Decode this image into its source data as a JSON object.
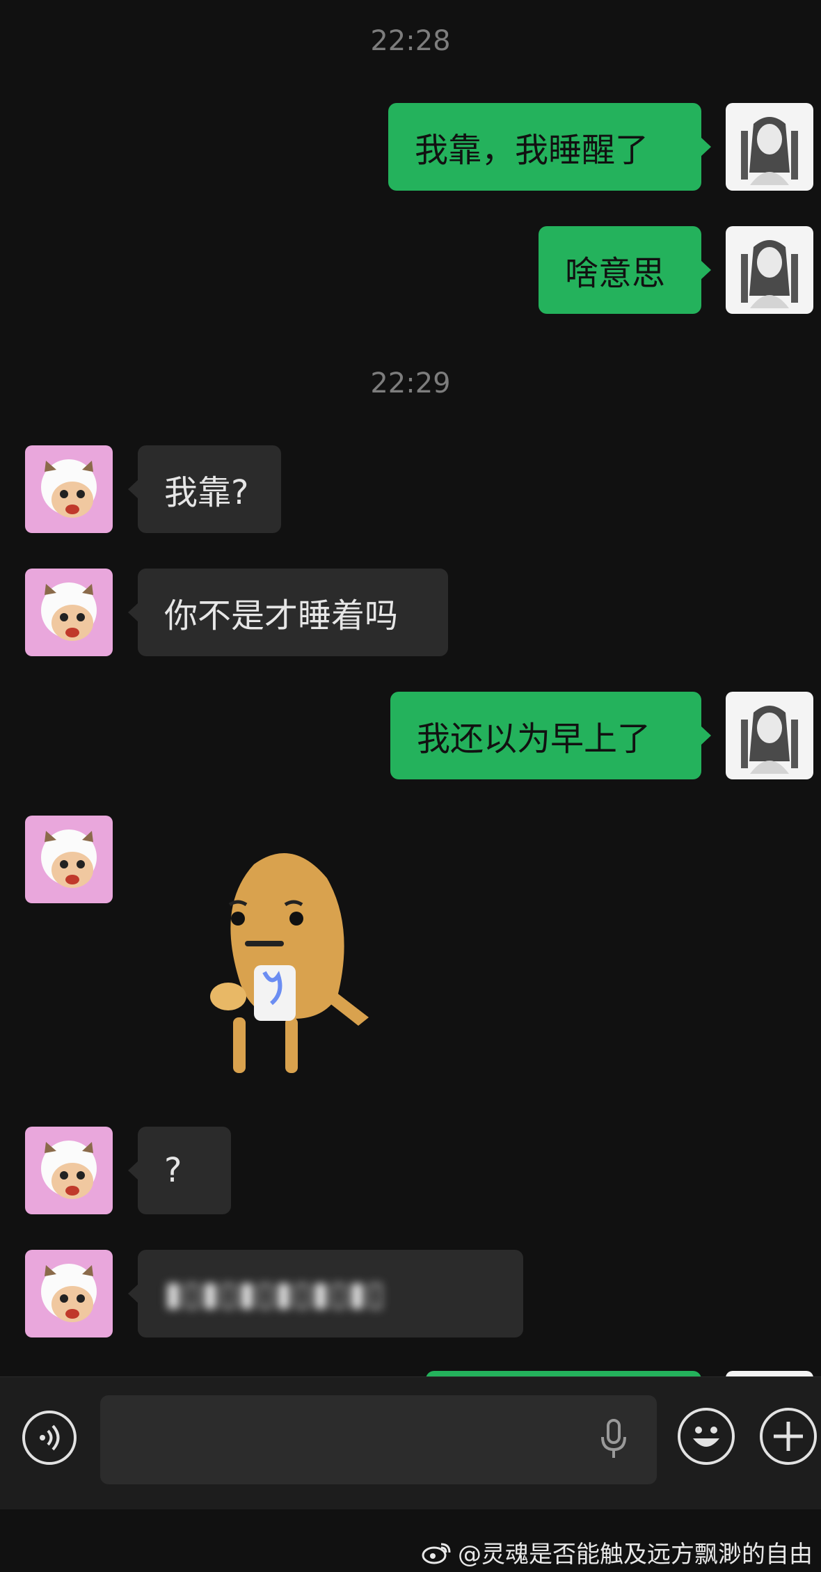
{
  "timestamps": [
    "22:28",
    "22:29"
  ],
  "messages": [
    {
      "dir": "out",
      "text": "我靠，我睡醒了"
    },
    {
      "dir": "out",
      "text": "啥意思"
    },
    {
      "dir": "in",
      "text": "我靠?"
    },
    {
      "dir": "in",
      "text": "你不是才睡着吗"
    },
    {
      "dir": "out",
      "text": "我还以为早上了"
    },
    {
      "dir": "in",
      "type": "sticker",
      "sticker": "potato-drinking-sticker"
    },
    {
      "dir": "in",
      "text": "?"
    },
    {
      "dir": "in",
      "text": "blurred",
      "blurred": true
    }
  ],
  "input_bar": {
    "voice_icon": "voice-toggle-icon",
    "mic_icon": "microphone-icon",
    "emoji_icon": "emoji-icon",
    "plus_icon": "plus-icon"
  },
  "watermark": "@灵魂是否能触及远方飘渺的自由",
  "colors": {
    "outgoing_bubble": "#24b25c",
    "incoming_bubble": "#2b2b2b",
    "background": "#111111"
  }
}
